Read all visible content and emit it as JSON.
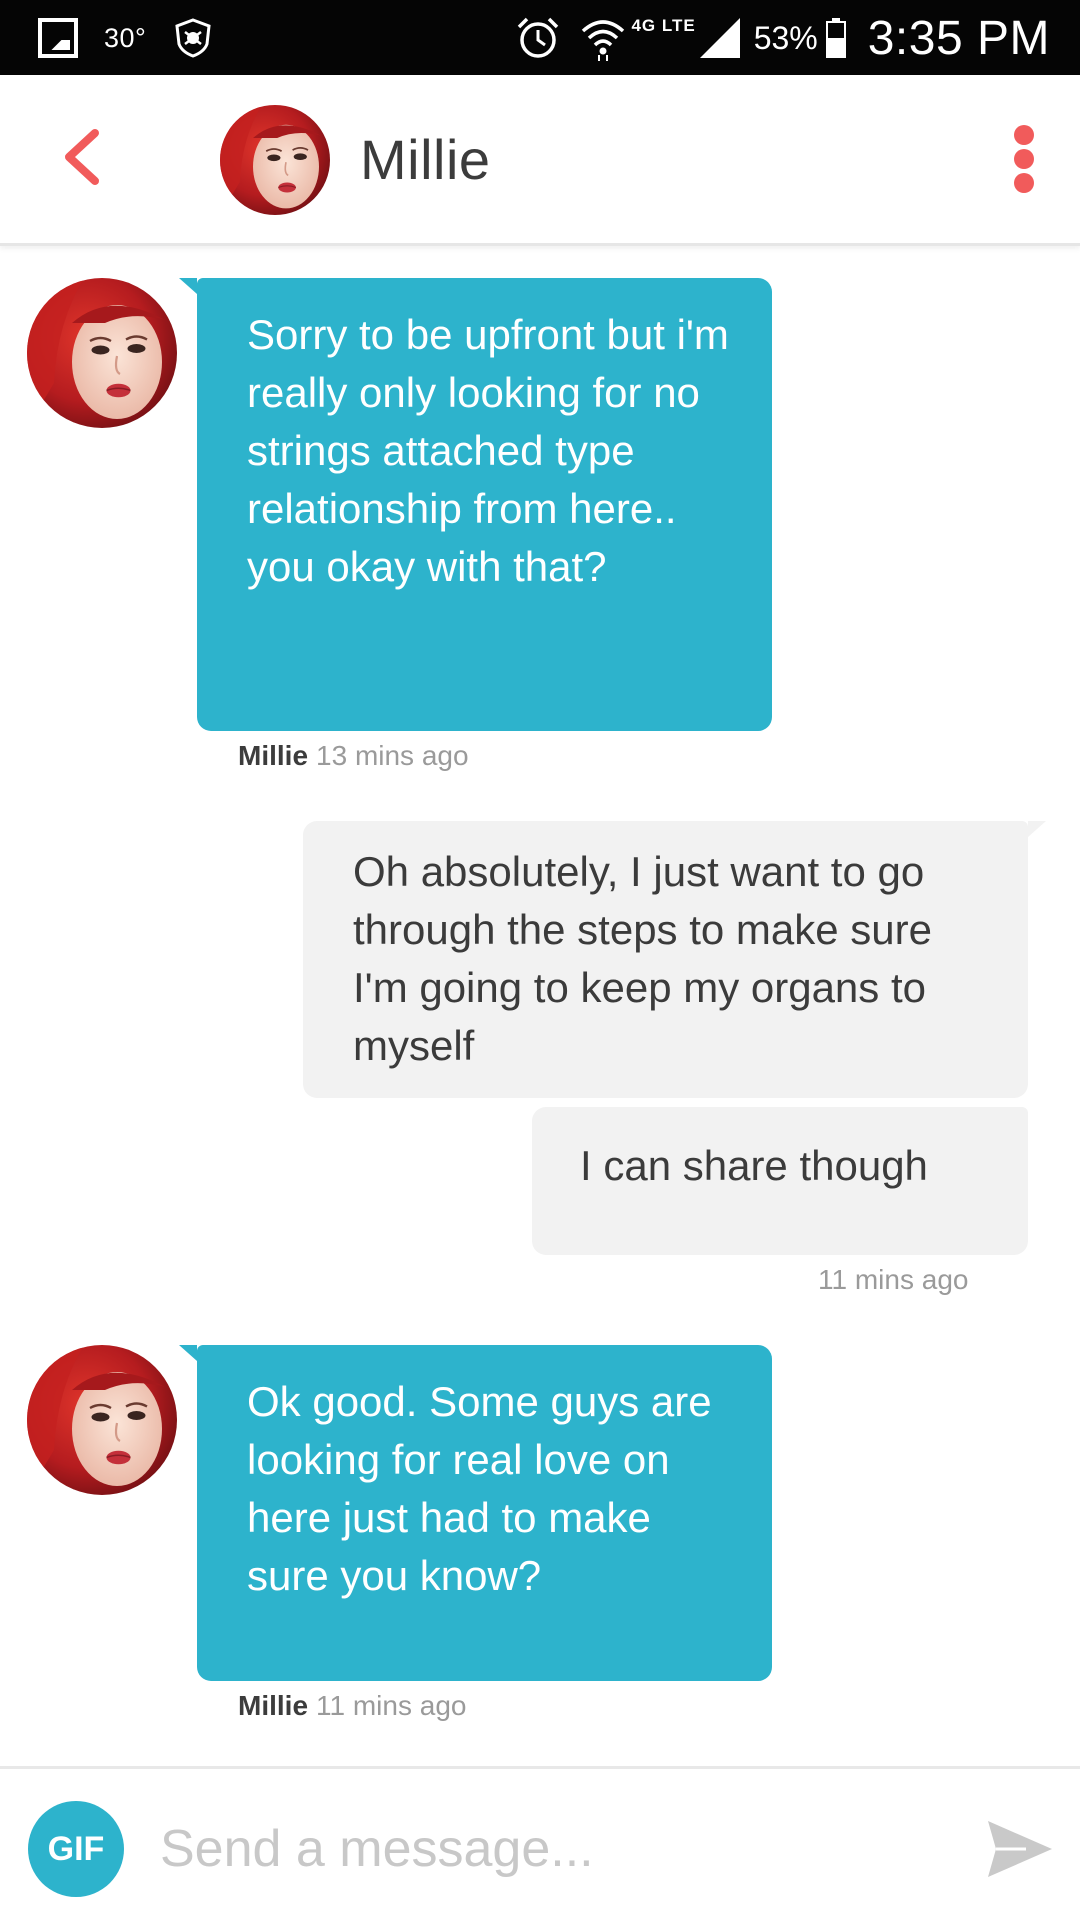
{
  "status_bar": {
    "temperature": "30°",
    "network": "4G LTE",
    "battery": "53%",
    "time": "3:35 PM"
  },
  "header": {
    "name": "Millie"
  },
  "messages": [
    {
      "direction": "incoming",
      "text": "Sorry to be upfront but i'm really only looking for no strings attached type relationship from here.. you okay with that?",
      "sender": "Millie",
      "time": "13 mins ago"
    },
    {
      "direction": "outgoing",
      "text": "Oh absolutely, I just want to go through the steps to make sure I'm going to keep my organs to myself"
    },
    {
      "direction": "outgoing",
      "text": "I can share though",
      "time": "11 mins ago"
    },
    {
      "direction": "incoming",
      "text": "Ok good. Some guys are looking for real love on here just had to make sure you know?",
      "sender": "Millie",
      "time": "11 mins ago"
    }
  ],
  "composer": {
    "gif_label": "GIF",
    "placeholder": "Send a message..."
  },
  "icons": {
    "back": "chevron-left-icon",
    "menu": "more-vertical-icon",
    "send": "send-icon"
  },
  "colors": {
    "incoming_bubble": "#2db3cc",
    "outgoing_bubble": "#f2f2f2",
    "accent": "#f15b5b",
    "status_bar": "#050505"
  }
}
